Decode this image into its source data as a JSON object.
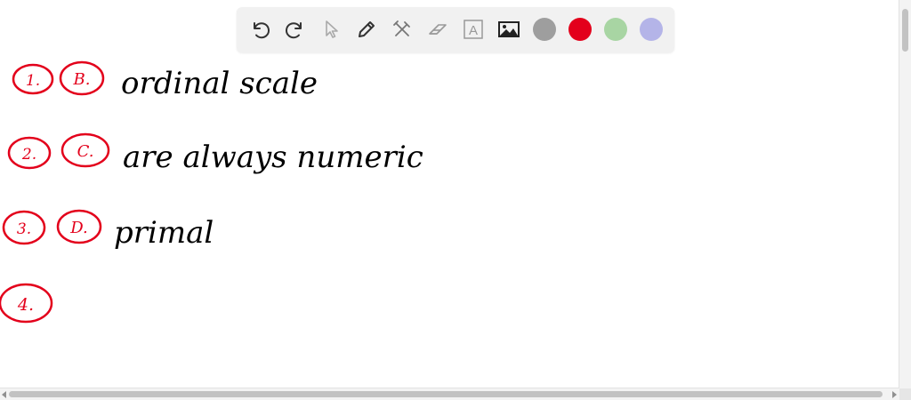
{
  "toolbar": {
    "tools": [
      {
        "name": "undo-icon",
        "label": "Undo"
      },
      {
        "name": "redo-icon",
        "label": "Redo"
      },
      {
        "name": "pointer-icon",
        "label": "Select"
      },
      {
        "name": "pen-icon",
        "label": "Pen"
      },
      {
        "name": "tools-icon",
        "label": "Tools"
      },
      {
        "name": "eraser-icon",
        "label": "Eraser"
      },
      {
        "name": "text-icon",
        "label": "A"
      },
      {
        "name": "image-icon",
        "label": "Image"
      }
    ],
    "colors": [
      "#9e9e9e",
      "#e3001b",
      "#a8d5a3",
      "#b4b4e8"
    ]
  },
  "notes": {
    "ink_colors": {
      "numbers": "#e3001b",
      "answers": "#000000"
    },
    "lines": [
      {
        "number": "1.",
        "choice": "B.",
        "answer": "ordinal scale"
      },
      {
        "number": "2.",
        "choice": "C.",
        "answer": "are always numeric"
      },
      {
        "number": "3.",
        "choice": "D.",
        "answer": "primal"
      },
      {
        "number": "4.",
        "choice": "",
        "answer": ""
      }
    ]
  }
}
